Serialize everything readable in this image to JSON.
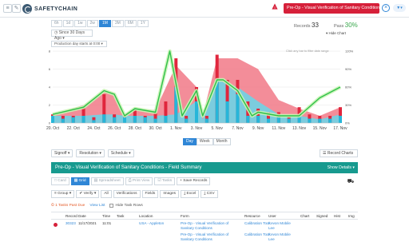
{
  "app": {
    "name": "SAFETYCHAIN"
  },
  "header": {
    "active_form": "Pre-Op - Visual Verification of Sanitary Conditions",
    "close_icon": "close-icon",
    "filter_icon": "funnel-icon",
    "alert_color": "#d6203a"
  },
  "range_buttons": [
    "6h",
    "1d",
    "1w",
    "2w",
    "1M",
    "3M",
    "6M",
    "1Y"
  ],
  "range_active": "1M",
  "since": "Since 30 Days Ago",
  "summary": {
    "records_label": "Records",
    "records": "33",
    "pass_label": "Pass",
    "pass": "30%"
  },
  "hide_chart": "Hide Chart",
  "production_day": "Production day starts at 0:00",
  "drag_hint": "Click any bar to filter date range",
  "view_modes": [
    "Day",
    "Week",
    "Month"
  ],
  "view_active": "Day",
  "filters": [
    "Signoff",
    "Resolution",
    "Schedule"
  ],
  "record_charts": "Record Charts",
  "banner": {
    "title": "Pre-Op - Visual Verification of Sanitary Conditions - Field Summary",
    "show": "Show Details"
  },
  "toolbar": [
    "Card",
    "Grid",
    "Spreadsheet",
    "Print View",
    "Tasks",
    "Save Records"
  ],
  "toolbar_active": "Grid",
  "toolbar2": [
    "Group",
    "Verify",
    "All",
    "Verifications",
    "Fields",
    "Images",
    "Excel",
    "CSV"
  ],
  "tasks": {
    "due": "1 Tasks Past Due",
    "view_list": "View List",
    "hide": "Hide Task Rows"
  },
  "table": {
    "columns": [
      "Record",
      "Date",
      "Time",
      "Task",
      "Location",
      "Form",
      "Resource",
      "User",
      "Chart",
      "Signed",
      "Hist",
      "Img"
    ],
    "rows": [
      {
        "record": "30323",
        "date": "11/17/2021",
        "time": "11:01",
        "task": "",
        "location": "USA - Appleton",
        "form": "Pre-Op - Visual Verification of Sanitary Conditions",
        "resource": "Calibration Tool",
        "user": "Kevon Mobile Lee"
      },
      {
        "record": "",
        "date": "",
        "time": "",
        "task": "",
        "location": "",
        "form": "Pre-Op - Visual Verification of Sanitary Conditions",
        "resource": "Calibration Tool",
        "user": "Kevon Mobile Lee"
      }
    ]
  },
  "chart_data": {
    "type": "area",
    "categories": [
      "20. Oct",
      "22. Oct",
      "24. Oct",
      "26. Oct",
      "28. Oct",
      "30. Oct",
      "1. Nov",
      "3. Nov",
      "5. Nov",
      "7. Nov",
      "9. Nov",
      "11. Nov",
      "13. Nov",
      "15. Nov",
      "17. Nov"
    ],
    "y_right_ticks": [
      "0%",
      "30%",
      "60%",
      "90%",
      "120%"
    ],
    "series": [
      {
        "type": "area",
        "color": "#f0707f",
        "x": [
          0,
          1.5,
          2.5,
          3,
          3.5,
          4,
          5,
          6,
          7,
          7.3,
          8,
          9,
          10,
          11,
          12,
          13,
          14
        ],
        "values": [
          0.12,
          0.25,
          0.45,
          0.42,
          0.12,
          0.2,
          0.18,
          0.8,
          0.5,
          0.1,
          0.9,
          0.9,
          0.75,
          0.32,
          0.2,
          0.1,
          0.22
        ]
      },
      {
        "type": "area",
        "color": "#6fd3e6",
        "x": [
          0,
          1.5,
          2.5,
          3,
          3.5,
          4,
          5,
          6,
          7,
          7.3,
          8,
          9,
          10,
          11,
          12,
          13,
          14
        ],
        "values": [
          0.1,
          0.1,
          0.12,
          0.12,
          0.1,
          0.1,
          0.1,
          0.12,
          0.3,
          0.05,
          0.6,
          0.5,
          0.3,
          0.12,
          0.1,
          0.05,
          0.12
        ]
      },
      {
        "type": "line",
        "color": "#2fbf4a",
        "x": [
          0,
          1.5,
          2.5,
          3,
          3.5,
          4,
          5,
          5.7,
          6.3,
          7,
          7.3,
          8,
          8.3,
          9,
          9.7,
          10,
          11,
          12,
          13,
          14
        ],
        "values": [
          0.12,
          0.22,
          0.45,
          0.4,
          0.1,
          0.2,
          0.15,
          1.0,
          0.1,
          0.45,
          0.1,
          0.6,
          0.6,
          0.45,
          0.1,
          0.15,
          0.1,
          0.1,
          0.35,
          0.5
        ]
      }
    ],
    "bars": {
      "x": [
        0,
        0.5,
        1,
        1.5,
        2,
        2.5,
        3,
        3.5,
        4,
        4.5,
        5,
        5.5,
        6,
        6.5,
        7,
        7.5,
        8,
        8.5,
        9,
        9.5,
        10,
        10.5,
        11,
        11.5,
        12,
        12.5,
        13,
        13.5,
        14
      ],
      "red": [
        0.12,
        0.1,
        0.1,
        0.22,
        0.08,
        0.4,
        0.12,
        0.1,
        0.2,
        0.1,
        0.15,
        0.3,
        0.9,
        0.1,
        0.5,
        0.1,
        0.95,
        0.6,
        0.6,
        0.3,
        0.2,
        0.15,
        0.15,
        0.1,
        0.22,
        0.12,
        0.1,
        0.1,
        0.22
      ],
      "blue": [
        0.1,
        0.06,
        0.08,
        0.1,
        0.04,
        0.12,
        0.08,
        0.08,
        0.1,
        0.08,
        0.06,
        0.1,
        0.5,
        0.06,
        0.3,
        0.06,
        0.6,
        0.3,
        0.4,
        0.1,
        0.1,
        0.06,
        0.08,
        0.06,
        0.1,
        0.06,
        0.06,
        0.06,
        0.1
      ]
    }
  }
}
